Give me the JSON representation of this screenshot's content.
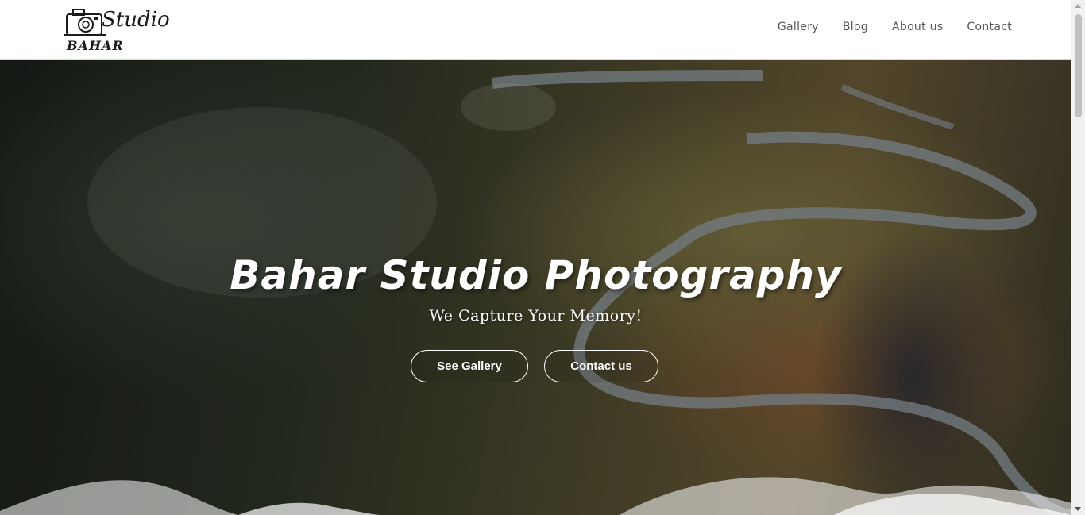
{
  "brand": {
    "name_top": "Studio",
    "name_bottom": "BAHAR",
    "logo_icon": "camera-icon"
  },
  "nav": {
    "items": [
      {
        "label": "Gallery"
      },
      {
        "label": "Blog"
      },
      {
        "label": "About us"
      },
      {
        "label": "Contact"
      }
    ]
  },
  "hero": {
    "title": "Bahar Studio Photography",
    "subtitle": "We Capture Your Memory!",
    "buttons": {
      "gallery": "See Gallery",
      "contact": "Contact us"
    }
  },
  "colors": {
    "header_bg": "#ffffff",
    "nav_text": "#555555",
    "hero_text": "#ffffff"
  }
}
